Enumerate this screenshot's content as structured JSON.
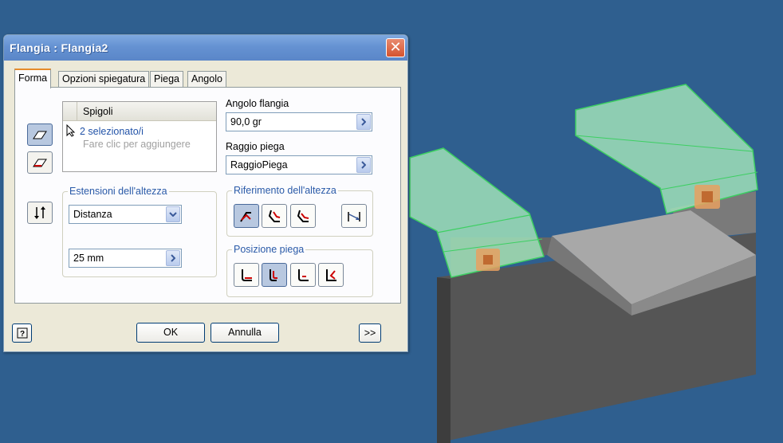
{
  "dialog": {
    "title": "Flangia : Flangia2",
    "close_label": "✕"
  },
  "tabs": [
    {
      "label": "Forma",
      "active": true
    },
    {
      "label": "Opzioni spiegatura",
      "active": false
    },
    {
      "label": "Piega",
      "active": false
    },
    {
      "label": "Angolo",
      "active": false
    }
  ],
  "edges": {
    "header": "Spigoli",
    "selected": "2 selezionato/i",
    "hint": "Fare clic per aggiungere"
  },
  "height_extents": {
    "label": "Estensioni dell'altezza",
    "type_value": "Distanza",
    "distance_value": "25 mm"
  },
  "flange_angle": {
    "label": "Angolo flangia",
    "value": "90,0 gr"
  },
  "bend_radius": {
    "label": "Raggio piega",
    "value": "RaggioPiega"
  },
  "height_reference": {
    "label": "Riferimento dell'altezza"
  },
  "bend_position": {
    "label": "Posizione piega"
  },
  "buttons": {
    "ok": "OK",
    "cancel": "Annulla",
    "more": ">>",
    "help": "?"
  },
  "colors": {
    "viewport_bg": "#2f5f8f",
    "flange_green": "#9fe0b8",
    "part_gray": "#5a5a5a",
    "accent_title": "#6592d2"
  }
}
